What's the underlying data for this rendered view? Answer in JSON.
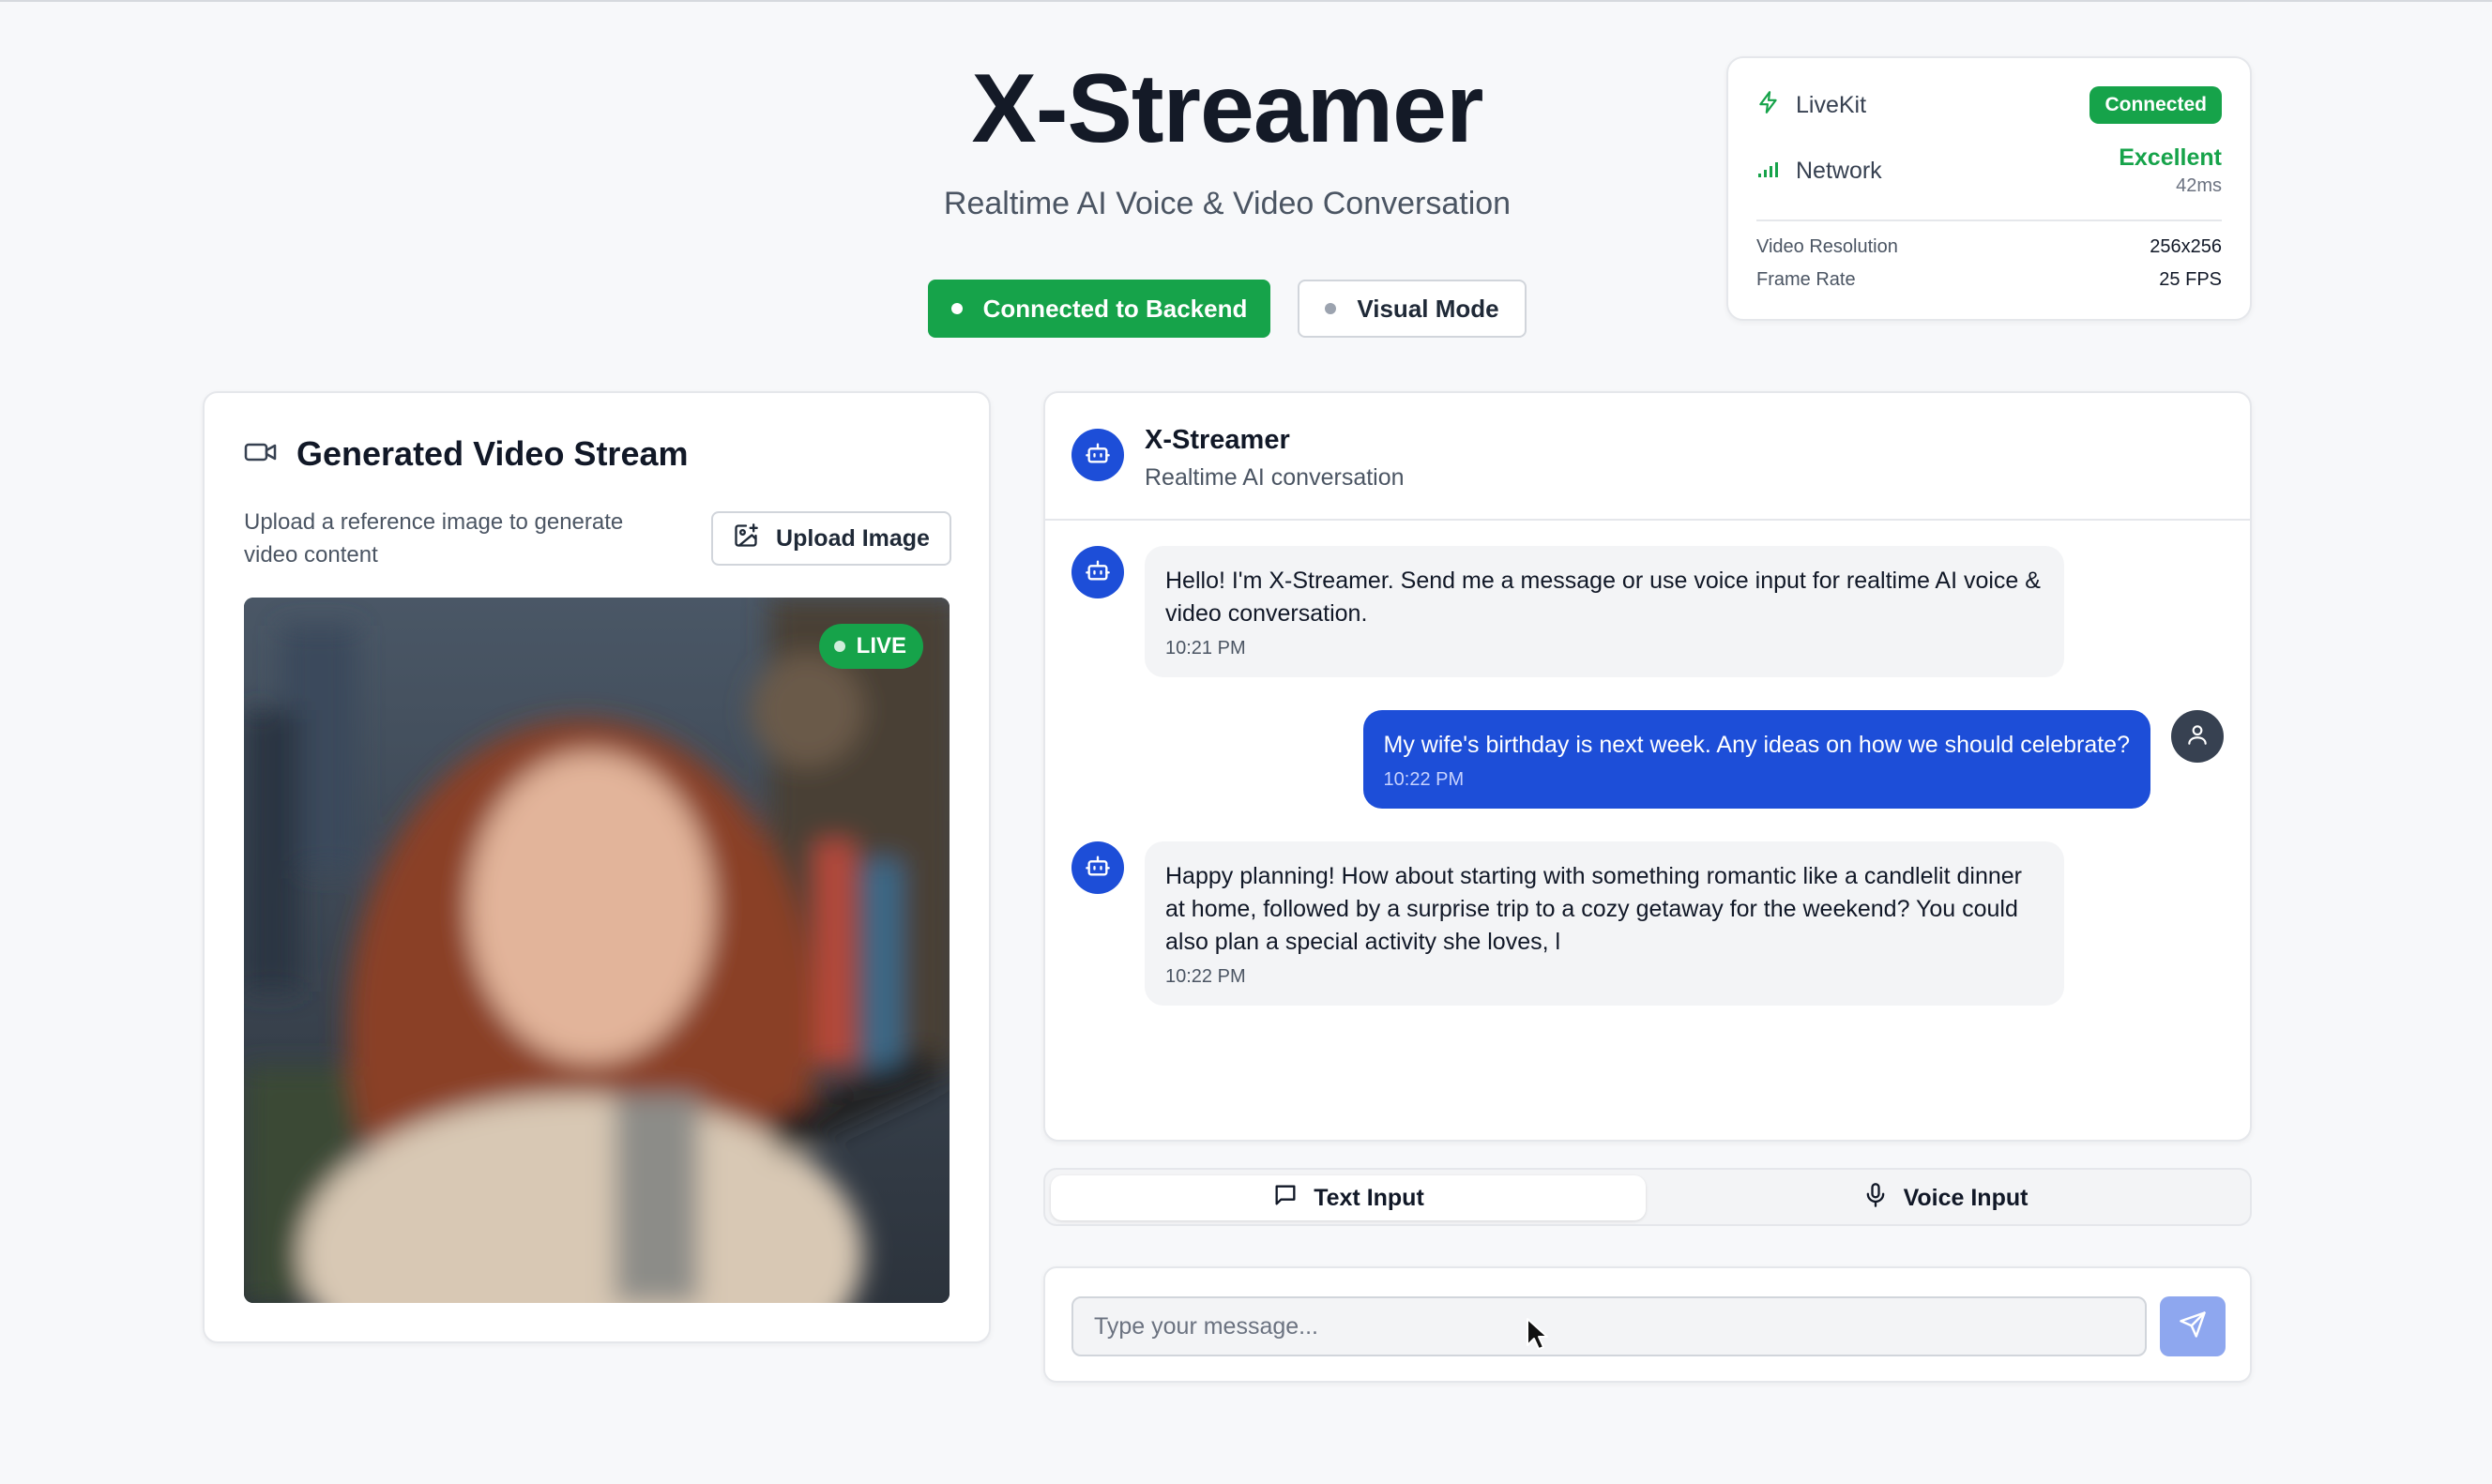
{
  "header": {
    "title": "X-Streamer",
    "subtitle": "Realtime AI Voice & Video Conversation",
    "connected_button": "Connected to Backend",
    "visual_mode_button": "Visual Mode"
  },
  "status": {
    "livekit_label": "LiveKit",
    "livekit_status": "Connected",
    "network_label": "Network",
    "network_quality": "Excellent",
    "network_latency": "42ms",
    "video_resolution_label": "Video Resolution",
    "video_resolution_value": "256x256",
    "frame_rate_label": "Frame Rate",
    "frame_rate_value": "25 FPS"
  },
  "video_panel": {
    "title": "Generated Video Stream",
    "description": "Upload a reference image to generate video content",
    "upload_button": "Upload Image",
    "live_badge": "LIVE"
  },
  "chat": {
    "name": "X-Streamer",
    "subtitle": "Realtime AI conversation",
    "messages": [
      {
        "role": "assistant",
        "text": "Hello! I'm X-Streamer. Send me a message or use voice input for realtime AI voice & video conversation.",
        "time": "10:21 PM"
      },
      {
        "role": "user",
        "text": "My wife's birthday is next week. Any ideas on how we should celebrate?",
        "time": "10:22 PM"
      },
      {
        "role": "assistant",
        "text": "Happy planning! How about starting with something romantic like a candlelit dinner at home, followed by a surprise trip to a cozy getaway for the weekend? You could also plan a special activity she loves, l",
        "time": "10:22 PM"
      }
    ]
  },
  "input_modes": {
    "text_tab": "Text Input",
    "voice_tab": "Voice Input",
    "active": "Text Input"
  },
  "composer": {
    "placeholder": "Type your message...",
    "value": ""
  },
  "icons": {
    "livekit": "lightning-icon",
    "network": "signal-bars-icon",
    "video": "video-camera-icon",
    "upload": "image-plus-icon",
    "bot": "bot-icon",
    "user": "user-icon",
    "text_tab": "chat-bubble-icon",
    "voice_tab": "microphone-icon",
    "send": "send-icon"
  },
  "colors": {
    "accent_green": "#16a34a",
    "accent_blue": "#1d4ed8",
    "send_disabled": "#8ea7ef"
  }
}
